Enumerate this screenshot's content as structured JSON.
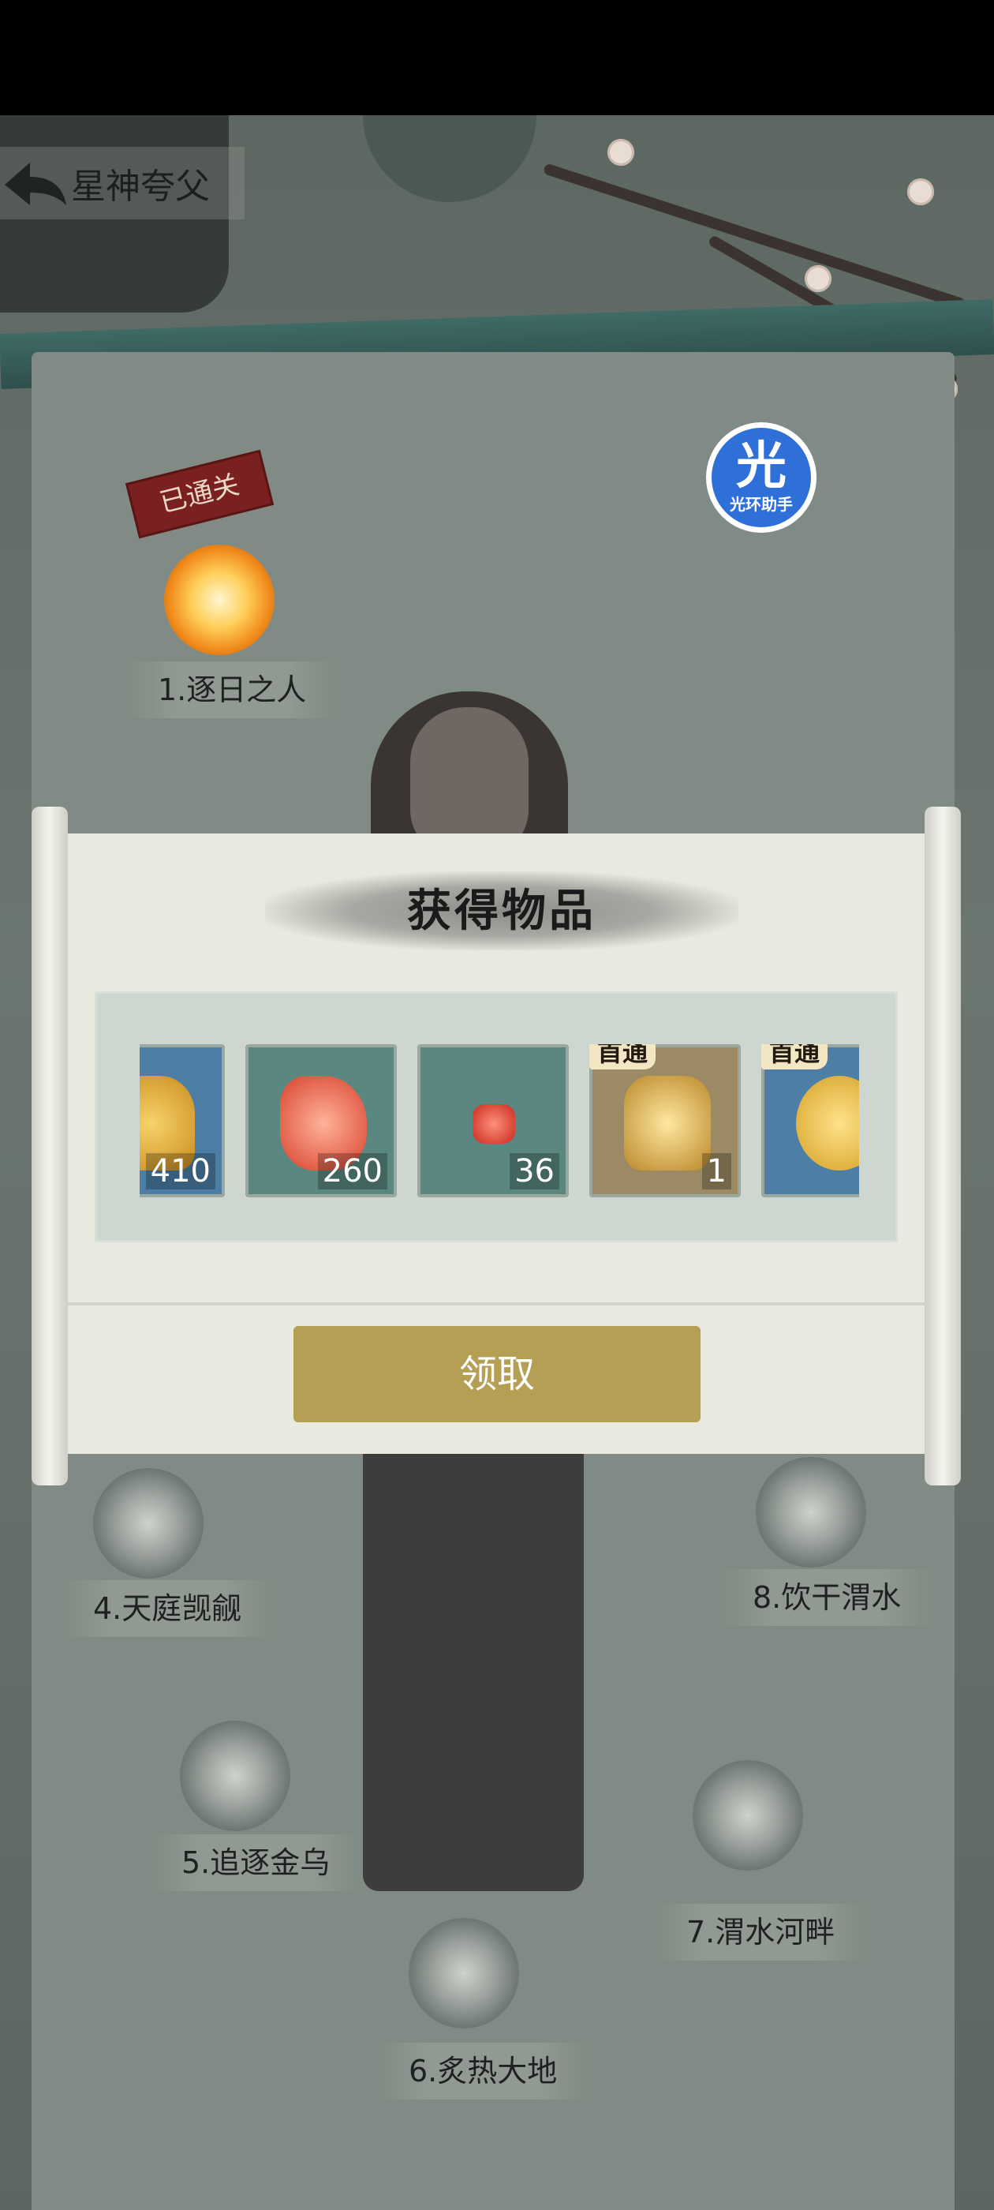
{
  "header": {
    "back_title": "星神夸父"
  },
  "helper": {
    "glyph": "光",
    "text": "光环助手"
  },
  "stage": {
    "cleared_stamp": "已通关",
    "nodes": [
      {
        "label": "1.逐日之人",
        "cleared": true
      },
      {
        "label": "4.天庭觊觎",
        "cleared": false
      },
      {
        "label": "5.追逐金乌",
        "cleared": false
      },
      {
        "label": "6.炙热大地",
        "cleared": false
      },
      {
        "label": "7.渭水河畔",
        "cleared": false
      },
      {
        "label": "8.饮干渭水",
        "cleared": false
      }
    ]
  },
  "dialog": {
    "title": "获得物品",
    "items": [
      {
        "icon": "ginseng-icon",
        "count": "410",
        "tag": ""
      },
      {
        "icon": "red-crystal-icon",
        "count": "260",
        "tag": ""
      },
      {
        "icon": "ruby-icon",
        "count": "36",
        "tag": ""
      },
      {
        "icon": "golden-boots-icon",
        "count": "1",
        "tag": "首通"
      },
      {
        "icon": "gold-ingot-icon",
        "count": "",
        "tag": "首通"
      }
    ],
    "claim_label": "领取"
  },
  "colors": {
    "claim_button": "#b59f55",
    "dialog_bg": "#e9eadf",
    "overlay": "#6b7670"
  }
}
